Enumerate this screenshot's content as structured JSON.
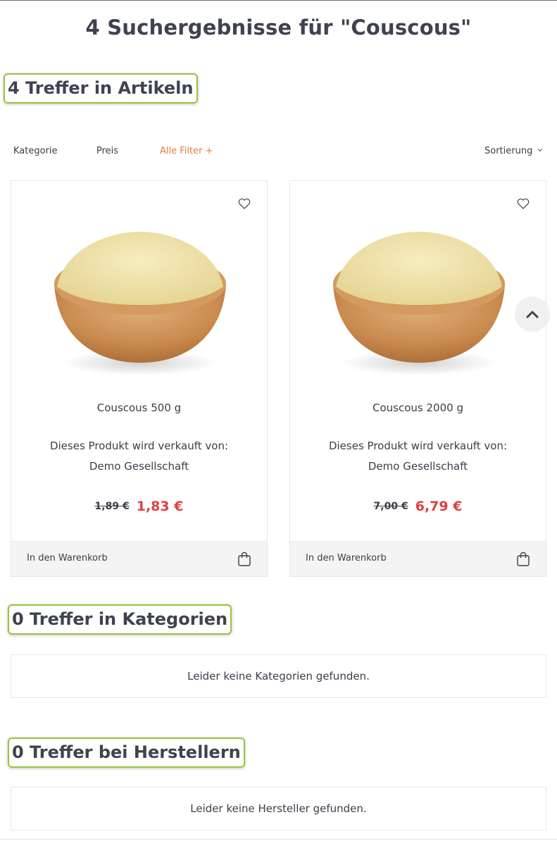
{
  "page_title": "4 Suchergebnisse für \"Couscous\"",
  "articles_heading": "4 Treffer in Artikeln",
  "filters": {
    "category": "Kategorie",
    "price": "Preis",
    "all_filters": "Alle Filter +",
    "sort": "Sortierung"
  },
  "products": [
    {
      "name": "Couscous 500 g",
      "seller_line1": "Dieses Produkt wird verkauft von:",
      "seller_line2": "Demo Gesellschaft",
      "old_price": "1,89 €",
      "price": "1,83 €",
      "cart_label": "In den Warenkorb"
    },
    {
      "name": "Couscous 2000 g",
      "seller_line1": "Dieses Produkt wird verkauft von:",
      "seller_line2": "Demo Gesellschaft",
      "old_price": "7,00 €",
      "price": "6,79 €",
      "cart_label": "In den Warenkorb"
    }
  ],
  "categories_heading": "0 Treffer in Kategorien",
  "categories_empty": "Leider keine Kategorien gefunden.",
  "manufacturers_heading": "0 Treffer bei Herstellern",
  "manufacturers_empty": "Leider keine Hersteller gefunden.",
  "colors": {
    "accent_green": "#9bc43a",
    "sale_red": "#e04040",
    "filter_orange": "#e8793c"
  },
  "icons": [
    "heart-icon",
    "cart-icon",
    "chevron-up-icon",
    "chevron-down-icon"
  ]
}
